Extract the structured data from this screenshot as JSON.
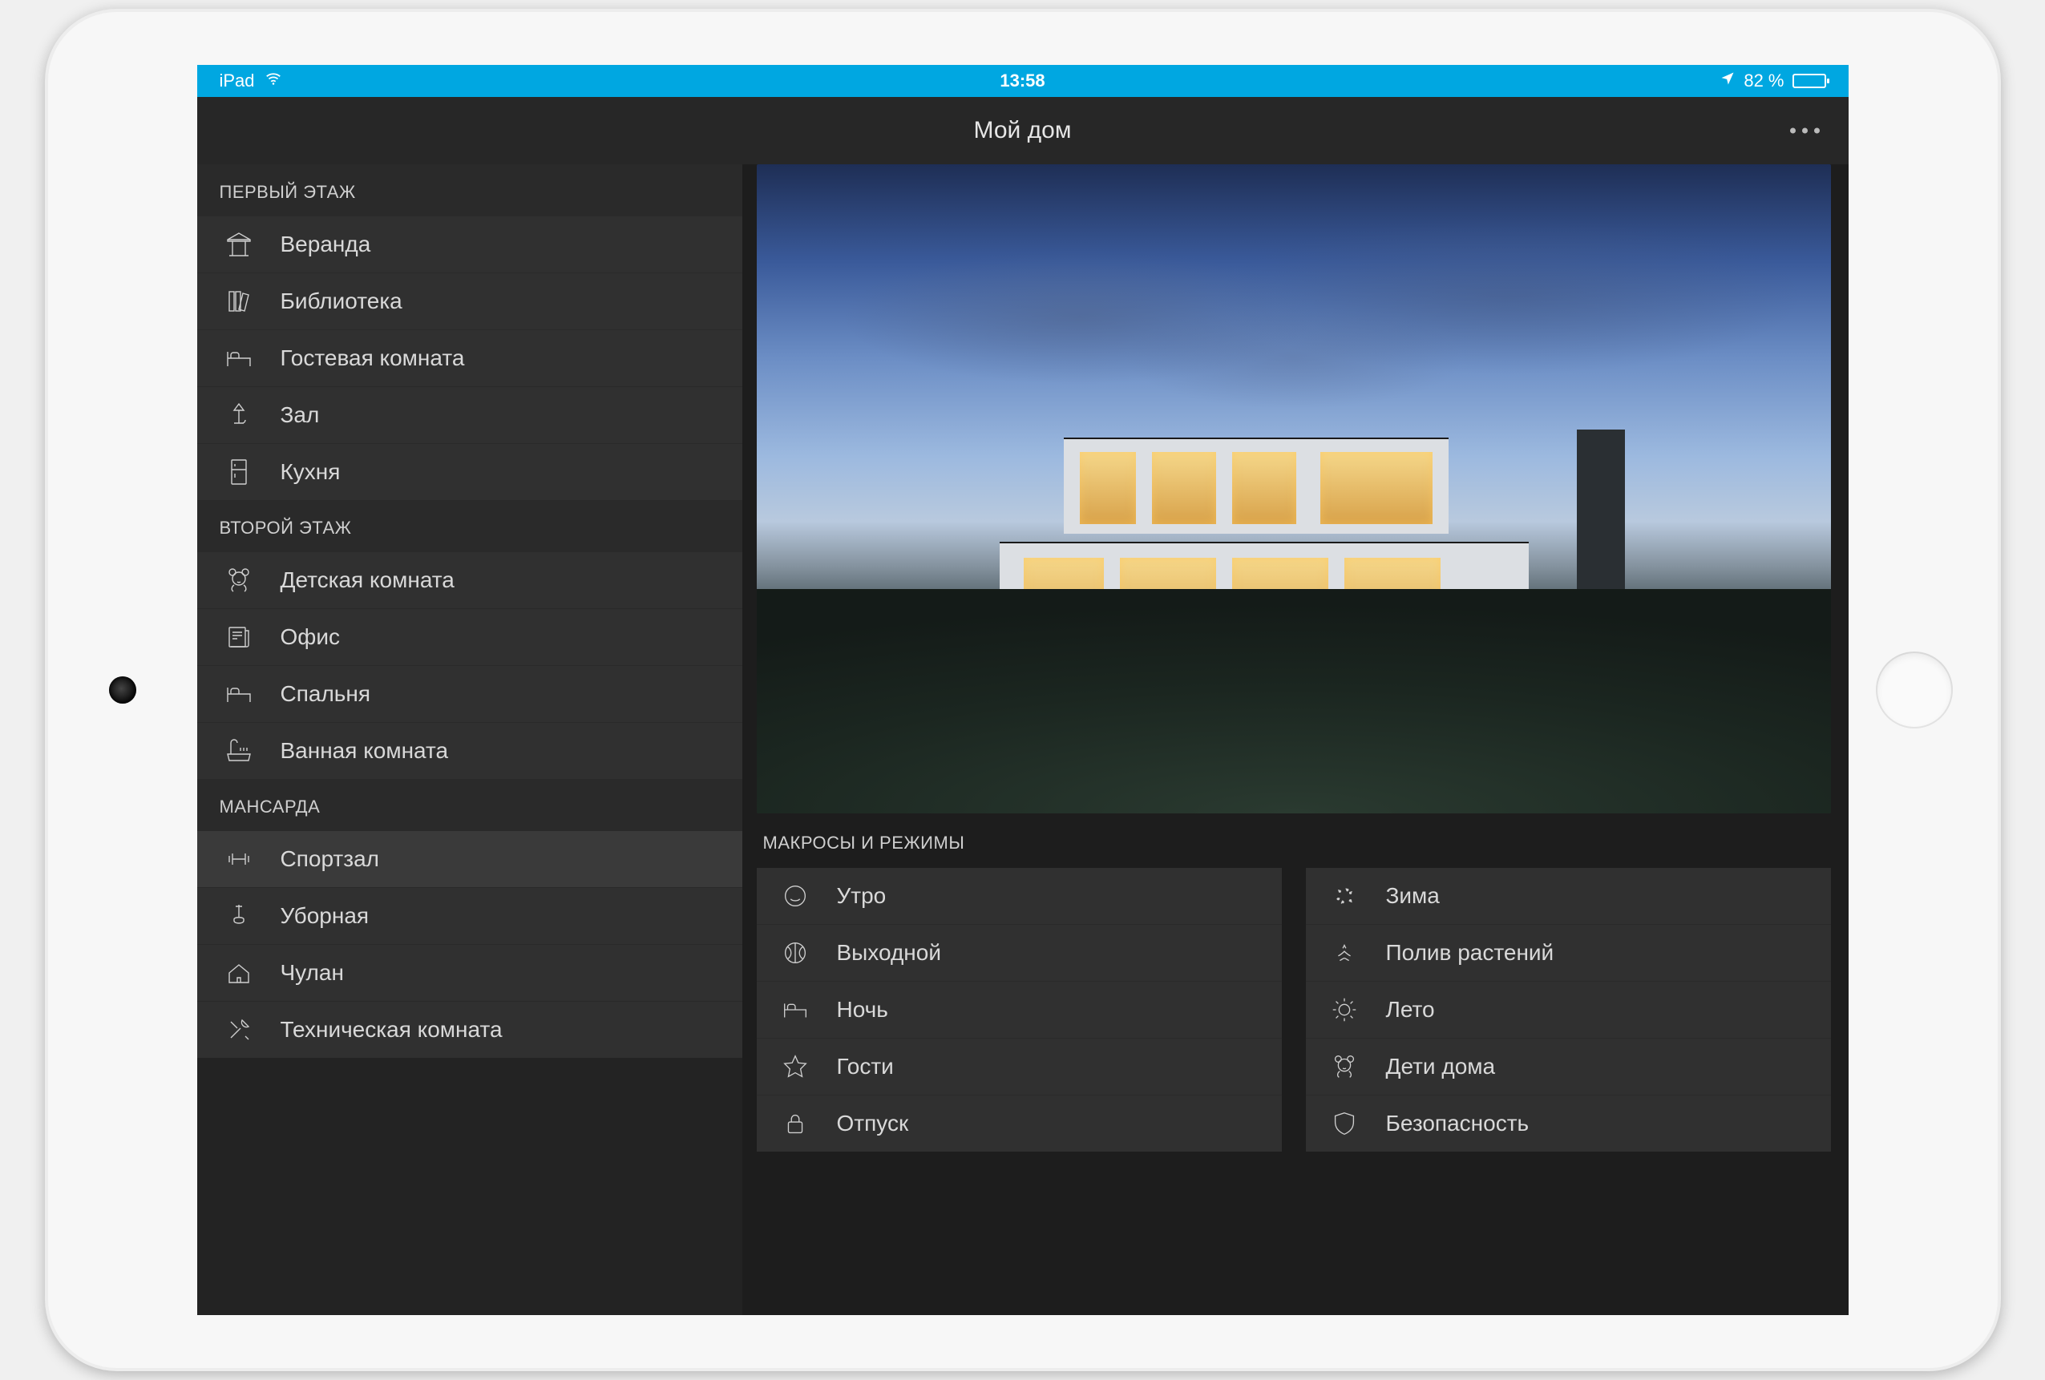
{
  "statusbar": {
    "device": "iPad",
    "time": "13:58",
    "battery_text": "82 %",
    "battery_pct": 82
  },
  "header": {
    "title": "Мой дом"
  },
  "sidebar": {
    "sections": [
      {
        "title": "ПЕРВЫЙ ЭТАЖ",
        "items": [
          {
            "icon": "gazebo",
            "label": "Веранда"
          },
          {
            "icon": "books",
            "label": "Библиотека"
          },
          {
            "icon": "bed",
            "label": "Гостевая комната"
          },
          {
            "icon": "lamp",
            "label": "Зал"
          },
          {
            "icon": "fridge",
            "label": "Кухня"
          }
        ]
      },
      {
        "title": "ВТОРОЙ ЭТАЖ",
        "items": [
          {
            "icon": "teddy",
            "label": "Детская комната"
          },
          {
            "icon": "newspaper",
            "label": "Офис"
          },
          {
            "icon": "bed",
            "label": "Спальня"
          },
          {
            "icon": "bath",
            "label": "Ванная комната"
          }
        ]
      },
      {
        "title": "МАНСАРДА",
        "items": [
          {
            "icon": "dumbbell",
            "label": "Спортзал",
            "selected": true
          },
          {
            "icon": "plunger",
            "label": "Уборная"
          },
          {
            "icon": "housebox",
            "label": "Чулан"
          },
          {
            "icon": "tools",
            "label": "Техническая комната"
          }
        ]
      }
    ]
  },
  "macros": {
    "title": "МАКРОСЫ И РЕЖИМЫ",
    "left": [
      {
        "icon": "smile",
        "label": "Утро"
      },
      {
        "icon": "ball",
        "label": "Выходной"
      },
      {
        "icon": "bed",
        "label": "Ночь"
      },
      {
        "icon": "star",
        "label": "Гости"
      },
      {
        "icon": "lock",
        "label": "Отпуск"
      }
    ],
    "right": [
      {
        "icon": "snow",
        "label": "Зима"
      },
      {
        "icon": "water",
        "label": "Полив растений"
      },
      {
        "icon": "sun",
        "label": "Лето"
      },
      {
        "icon": "teddy",
        "label": "Дети дома"
      },
      {
        "icon": "shield",
        "label": "Безопасность"
      }
    ]
  }
}
